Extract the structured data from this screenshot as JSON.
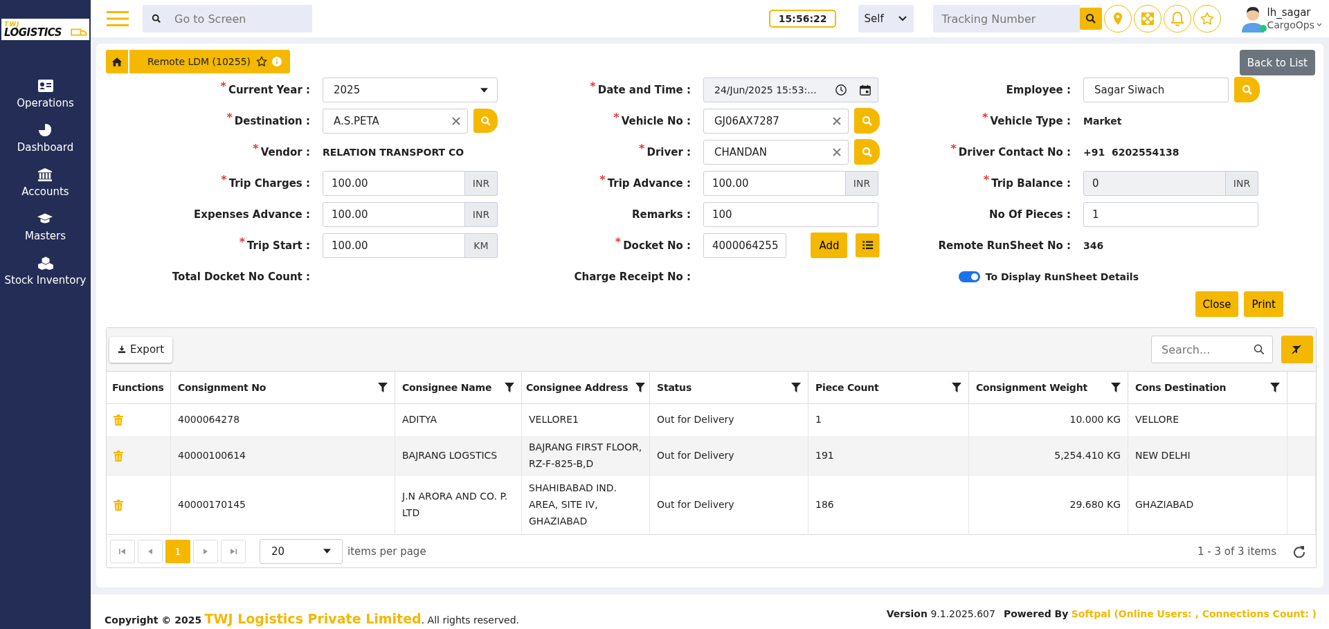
{
  "logo": {
    "line1": "TWJ",
    "line2": "LOGISTICS"
  },
  "topbar": {
    "search_placeholder": "Go to Screen",
    "clock": "15:56:22",
    "mode": "Self",
    "tracking_placeholder": "Tracking Number",
    "user": {
      "name": "lh_sagar",
      "role": "CargoOps",
      "online": true
    }
  },
  "sidebar": {
    "items": [
      {
        "label": "Operations"
      },
      {
        "label": "Dashboard"
      },
      {
        "label": "Accounts"
      },
      {
        "label": "Masters"
      },
      {
        "label": "Stock Inventory"
      }
    ]
  },
  "breadcrumb": {
    "title": "Remote LDM (10255)"
  },
  "back_button": "Back to List",
  "form": {
    "rows": [
      [
        {
          "kind": "select",
          "label": "Current Year :",
          "marker": "*",
          "value": "2025"
        },
        {
          "kind": "datetime",
          "label": "Date and Time :",
          "marker": "*",
          "value": "24/Jun/2025 15:53:..."
        },
        {
          "kind": "search",
          "label": "Employee :",
          "value": "Sagar Siwach",
          "clearable": false
        }
      ],
      [
        {
          "kind": "search",
          "label": "Destination :",
          "marker": "*",
          "value": "A.S.PETA",
          "clearable": true
        },
        {
          "kind": "search",
          "label": "Vehicle No :",
          "marker": "*",
          "value": "GJ06AX7287",
          "clearable": true
        },
        {
          "kind": "static",
          "label": "Vehicle Type :",
          "marker": "*",
          "value": "Market"
        }
      ],
      [
        {
          "kind": "static",
          "label": "Vendor :",
          "marker": "*",
          "value": "RELATION TRANSPORT CO"
        },
        {
          "kind": "search",
          "label": "Driver :",
          "marker": "*",
          "value": "CHANDAN",
          "clearable": true
        },
        {
          "kind": "static",
          "label": "Driver Contact No :",
          "marker": "*",
          "value": "+91  6202554138"
        }
      ],
      [
        {
          "kind": "addon",
          "label": "Trip Charges :",
          "marker": "*",
          "value": "100.00",
          "addon": "INR",
          "disabled": false
        },
        {
          "kind": "addon",
          "label": "Trip Advance :",
          "marker": "*",
          "value": "100.00",
          "addon": "INR",
          "disabled": false
        },
        {
          "kind": "addon",
          "label": "Trip Balance :",
          "marker": "*",
          "value": "0",
          "addon": "INR",
          "disabled": true
        }
      ],
      [
        {
          "kind": "addon",
          "label": "Expenses Advance :",
          "value": "100.00",
          "addon": "INR",
          "disabled": false
        },
        {
          "kind": "text",
          "label": "Remarks :",
          "value": "100"
        },
        {
          "kind": "text",
          "label": "No Of Pieces :",
          "value": "1"
        }
      ],
      [
        {
          "kind": "addon",
          "label": "Trip Start :",
          "marker": "*",
          "value": "100.00",
          "addon": "KM",
          "disabled": false
        },
        {
          "kind": "docket",
          "label": "Docket No :",
          "marker": "*",
          "value": "4000064255",
          "button": "Add"
        },
        {
          "kind": "static",
          "label": "Remote RunSheet No :",
          "value": "346"
        }
      ],
      [
        {
          "kind": "static",
          "label": "Total Docket No Count :"
        },
        {
          "kind": "static",
          "label": "Charge Receipt No :"
        },
        {
          "kind": "toggle",
          "label": "To Display RunSheet Details",
          "on": true
        }
      ]
    ],
    "buttons": [
      "Close",
      "Print"
    ]
  },
  "grid": {
    "export": "Export",
    "search_placeholder": "Search...",
    "columns": [
      {
        "label": "Functions",
        "filter": false
      },
      {
        "label": "Consignment No",
        "filter": true
      },
      {
        "label": "Consignee Name",
        "filter": true
      },
      {
        "label": "Consignee Address",
        "filter": true
      },
      {
        "label": "Status",
        "filter": true
      },
      {
        "label": "Piece Count",
        "filter": true
      },
      {
        "label": "Consignment Weight",
        "filter": true
      },
      {
        "label": "Cons Destination",
        "filter": true
      }
    ],
    "rows": [
      [
        "",
        "4000064278",
        "ADITYA",
        "VELLORE1",
        "Out for Delivery",
        "1",
        "10.000 KG",
        "VELLORE"
      ],
      [
        "",
        "40000100614",
        "BAJRANG LOGSTICS",
        "BAJRANG FIRST FLOOR, RZ-F-825-B,D",
        "Out for Delivery",
        "191",
        "5,254.410 KG",
        "NEW DELHI"
      ],
      [
        "",
        "40000170145",
        "J.N ARORA AND CO. P. LTD",
        "SHAHIBABAD IND. AREA, SITE IV, GHAZIABAD",
        "Out for Delivery",
        "186",
        "29.680 KG",
        "GHAZIABAD"
      ]
    ],
    "pager": {
      "pages": [
        {
          "label": "1",
          "selected": true
        }
      ],
      "per_page": "20",
      "per_page_label": "items per page",
      "summary": "1 - 3 of 3 items"
    }
  },
  "footer": {
    "copyright": "Copyright © 2025",
    "company": "TWJ Logistics Private Limited",
    "rights": ". All rights reserved.",
    "version_label": "Version",
    "version": "9.1.2025.607",
    "powered_label": "Powered By",
    "powered": "Softpal (Online Users: , Connections Count: )"
  }
}
